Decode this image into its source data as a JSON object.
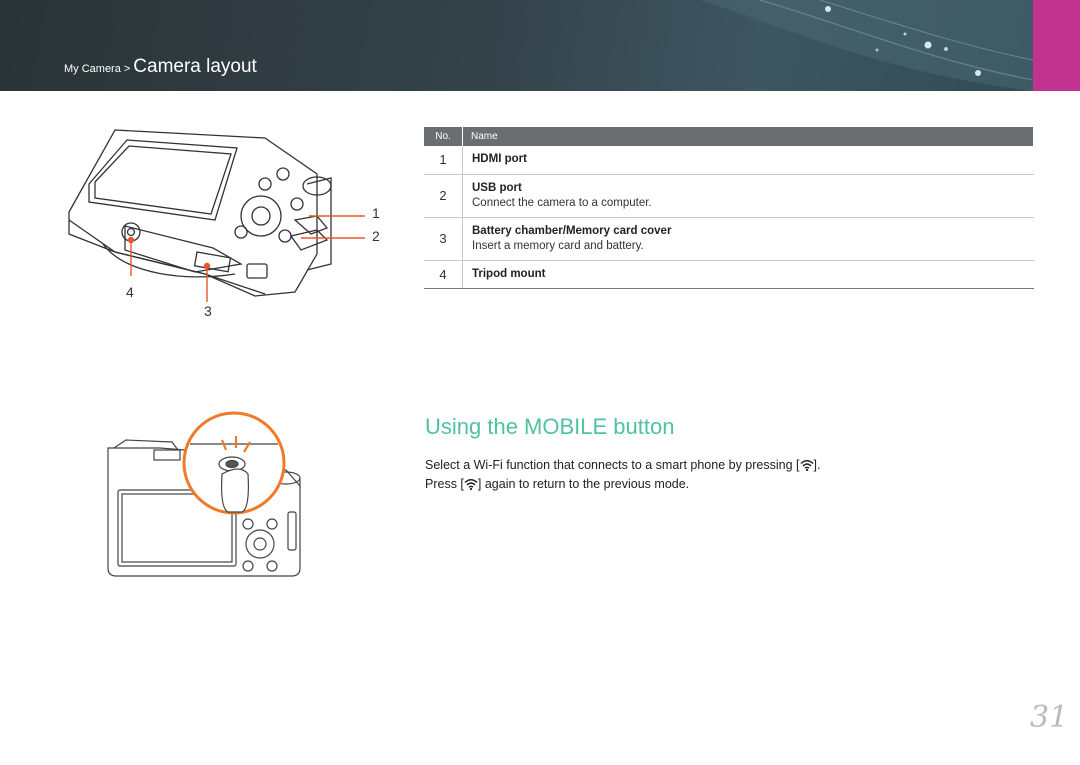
{
  "header": {
    "breadcrumb_parent": "My Camera",
    "breadcrumb_separator": ">",
    "breadcrumb_current": "Camera layout",
    "accent_color": "#c0338f"
  },
  "figure_top": {
    "callouts": [
      "1",
      "2",
      "3",
      "4"
    ]
  },
  "table": {
    "headers": {
      "no": "No.",
      "name": "Name"
    },
    "rows": [
      {
        "no": "1",
        "name": "HDMI port",
        "desc": ""
      },
      {
        "no": "2",
        "name": "USB port",
        "desc": "Connect the camera to a computer."
      },
      {
        "no": "3",
        "name": "Battery chamber/Memory card cover",
        "desc": "Insert a memory card and battery."
      },
      {
        "no": "4",
        "name": "Tripod mount",
        "desc": ""
      }
    ]
  },
  "section": {
    "title": "Using the MOBILE button",
    "line1_a": "Select a Wi-Fi function that connects to a smart phone by pressing [",
    "line1_b": "].",
    "line2_a": "Press [",
    "line2_b": "] again to return to the previous mode.",
    "title_color": "#4fc3a1",
    "icon": "wifi-icon"
  },
  "page_number": "31"
}
